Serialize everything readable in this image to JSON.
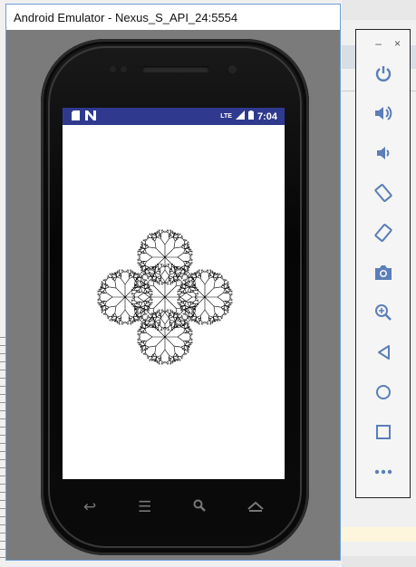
{
  "window": {
    "title": "Android Emulator - Nexus_S_API_24:5554"
  },
  "status_bar": {
    "time": "7:04",
    "lte": "LTE"
  },
  "sidebar": {
    "window_controls": [
      "–",
      "×"
    ],
    "buttons": [
      {
        "name": "power",
        "icon": "power-icon"
      },
      {
        "name": "volume-up",
        "icon": "volume-up-icon"
      },
      {
        "name": "volume-down",
        "icon": "volume-down-icon"
      },
      {
        "name": "rotate-left",
        "icon": "rotate-left-icon"
      },
      {
        "name": "rotate-right",
        "icon": "rotate-right-icon"
      },
      {
        "name": "screenshot",
        "icon": "camera-icon"
      },
      {
        "name": "zoom",
        "icon": "zoom-icon"
      },
      {
        "name": "back",
        "icon": "back-icon"
      },
      {
        "name": "home",
        "icon": "home-icon"
      },
      {
        "name": "overview",
        "icon": "overview-icon"
      },
      {
        "name": "more",
        "icon": "more-icon"
      }
    ]
  },
  "phone_nav": {
    "icons": [
      "back-icon",
      "menu-icon",
      "search-icon",
      "home-icon"
    ]
  },
  "colors": {
    "status_bar": "#2f3a8f",
    "sidebar_icon": "#5b7fb8",
    "window_border": "#6aa0d8"
  }
}
